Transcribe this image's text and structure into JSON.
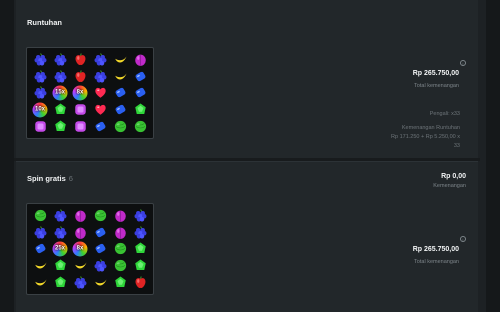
{
  "tumble": {
    "title": "Runtuhan",
    "total_amount": "Rp 265.750,00",
    "total_label": "Total kemenangan",
    "multiplier_text": "Pengali: x33",
    "win_title": "Kemenangan Runtuhan",
    "win_formula_1": "Rp 171.250 + Rp 5.250,00 x",
    "win_formula_2": "33",
    "grid": [
      [
        "grape",
        "grape",
        "apple",
        "grape",
        "banana",
        "plum"
      ],
      [
        "grape",
        "grape",
        "apple",
        "grape",
        "banana",
        "blue"
      ],
      [
        "grape",
        "mult:15x",
        "mult:8x",
        "heart",
        "blue",
        "blue"
      ],
      [
        "mult:10x",
        "green",
        "purple",
        "heart",
        "blue",
        "green"
      ],
      [
        "purple",
        "green",
        "purple",
        "blue",
        "melon",
        "melon"
      ]
    ]
  },
  "freespins": {
    "title": "Spin gratis",
    "count": "6",
    "win_amount": "Rp 0,00",
    "win_label": "Kemenangan",
    "total_amount": "Rp 265.750,00",
    "total_label": "Total kemenangan",
    "grid": [
      [
        "melon",
        "grape",
        "plum",
        "melon",
        "plum",
        "grape"
      ],
      [
        "grape",
        "grape",
        "plum",
        "blue",
        "plum",
        "grape"
      ],
      [
        "blue",
        "mult:25x",
        "mult:8x",
        "blue",
        "melon",
        "green"
      ],
      [
        "banana",
        "green",
        "banana",
        "grape",
        "melon",
        "green"
      ],
      [
        "banana",
        "green",
        "grape",
        "banana",
        "green",
        "apple"
      ]
    ]
  },
  "colors": {
    "grape": "#3b3fe0",
    "apple": "#e02424",
    "banana": "#f4d92a",
    "plum": "#c02ac9",
    "blue": "#2a5ff0",
    "heart": "#ff2a52",
    "green": "#2fd63a",
    "purple": "#c44ae8",
    "melon": "#39c233"
  }
}
